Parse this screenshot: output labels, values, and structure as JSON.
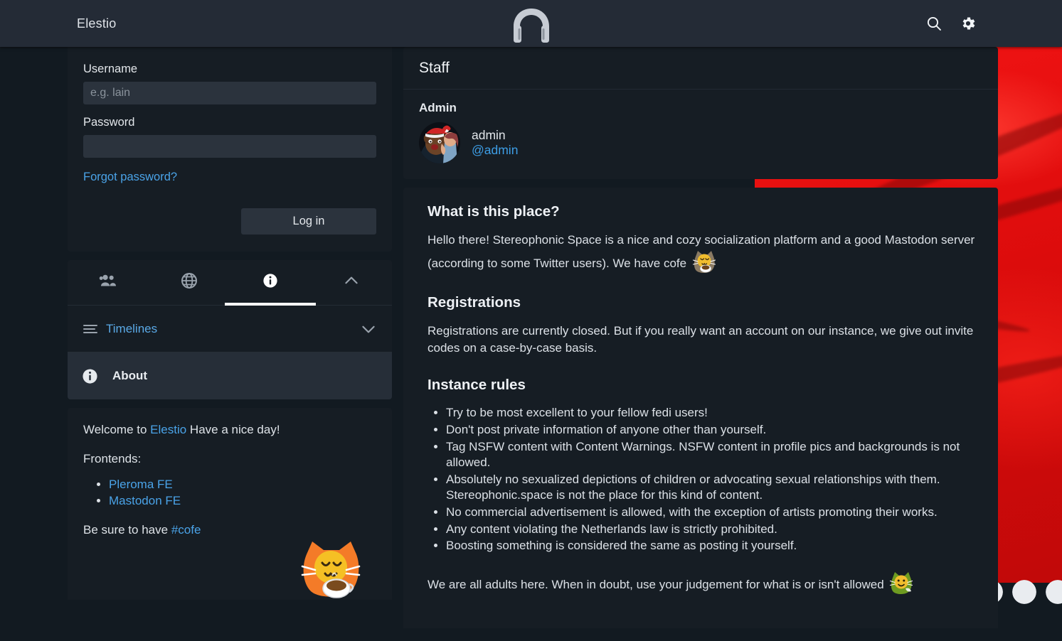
{
  "header": {
    "site_name": "Elestio",
    "logo_icon": "headphones-icon",
    "search_icon": "search-icon",
    "settings_icon": "gear-icon"
  },
  "login": {
    "username_label": "Username",
    "username_placeholder": "e.g. lain",
    "username_value": "",
    "password_label": "Password",
    "password_value": "",
    "forgot_label": "Forgot password?",
    "submit_label": "Log in"
  },
  "nav": {
    "tabs": [
      {
        "icon": "people-group-icon",
        "active": false
      },
      {
        "icon": "globe-icon",
        "active": false
      },
      {
        "icon": "info-circle-icon",
        "active": true
      }
    ],
    "collapse_icon": "chevron-up-icon",
    "rows": [
      {
        "icon": "hamburger-icon",
        "label": "Timelines",
        "caret": "chevron-down-icon",
        "active": false
      },
      {
        "icon": "info-circle-icon",
        "label": "About",
        "caret": "",
        "active": true
      }
    ]
  },
  "welcome": {
    "line1_pre": "Welcome to ",
    "line1_link": "Elestio",
    "line1_post": " Have a nice day!",
    "frontends_label": "Frontends:",
    "frontends": [
      "Pleroma FE",
      "Mastodon FE"
    ],
    "cofe_pre": "Be sure to have ",
    "cofe_tag": "#cofe",
    "cat_emoji": "orange-cat-cofe-emoji"
  },
  "staff": {
    "title": "Staff",
    "role": "Admin",
    "display_name": "admin",
    "handle": "@admin",
    "avatar_icon": "admin-avatar"
  },
  "about": {
    "what_heading": "What is this place?",
    "what_body": "Hello there! Stereophonic Space is a nice and cozy socialization platform and a good Mastodon server (according to some Twitter users). We have cofe",
    "what_emoji": "brown-cat-cofe-emoji",
    "registrations_heading": "Registrations",
    "registrations_body": "Registrations are currently closed. But if you really want an account on our instance, we give out invite codes on a case-by-case basis.",
    "rules_heading": "Instance rules",
    "rules": [
      "Try to be most excellent to your fellow fedi users!",
      "Don't post private information of anyone other than yourself.",
      "Tag NSFW content with Content Warnings. NSFW content in profile pics and backgrounds is not allowed.",
      "Absolutely no sexualized depictions of children or advocating sexual relationships with them. Stereophonic.space is not the place for this kind of content.",
      "No commercial advertisement is allowed, with the exception of artists promoting their works.",
      "Any content violating the Netherlands law is strictly prohibited.",
      "Boosting something is considered the same as posting it yourself."
    ],
    "closing": "We are all adults here. When in doubt, use your judgement for what is or isn't allowed",
    "closing_emoji": "green-cat-emoji"
  },
  "colors": {
    "topbar": "#242b36",
    "panel": "#161d24",
    "page_bg": "#121a21",
    "link": "#4aa3e8",
    "text": "#dde2e7",
    "input_bg": "#2b333d",
    "active_row": "#262e38",
    "background_image_red": "#e60f0f"
  }
}
